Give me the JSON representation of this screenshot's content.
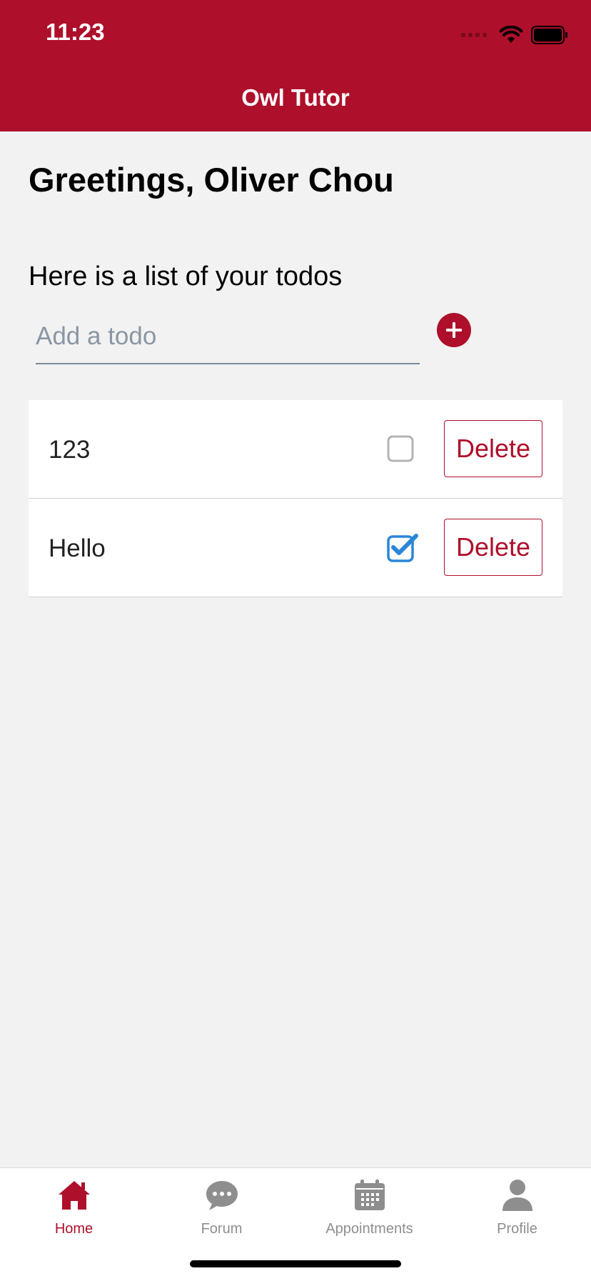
{
  "status_bar": {
    "time": "11:23"
  },
  "header": {
    "title": "Owl Tutor"
  },
  "greeting": "Greetings, Oliver Chou",
  "todo_section": {
    "subtitle": "Here is a list of your todos",
    "input_placeholder": "Add a todo",
    "input_value": ""
  },
  "todos": [
    {
      "text": "123",
      "checked": false,
      "delete_label": "Delete"
    },
    {
      "text": "Hello",
      "checked": true,
      "delete_label": "Delete"
    }
  ],
  "tabs": [
    {
      "label": "Home",
      "icon": "home-icon",
      "active": true
    },
    {
      "label": "Forum",
      "icon": "chat-bubble-icon",
      "active": false
    },
    {
      "label": "Appointments",
      "icon": "calendar-icon",
      "active": false
    },
    {
      "label": "Profile",
      "icon": "user-icon",
      "active": false
    }
  ],
  "colors": {
    "brand": "#ae0f2a",
    "background": "#f2f2f2",
    "checkbox_checked": "#2a86d8",
    "tab_inactive": "#8e8e8e"
  }
}
